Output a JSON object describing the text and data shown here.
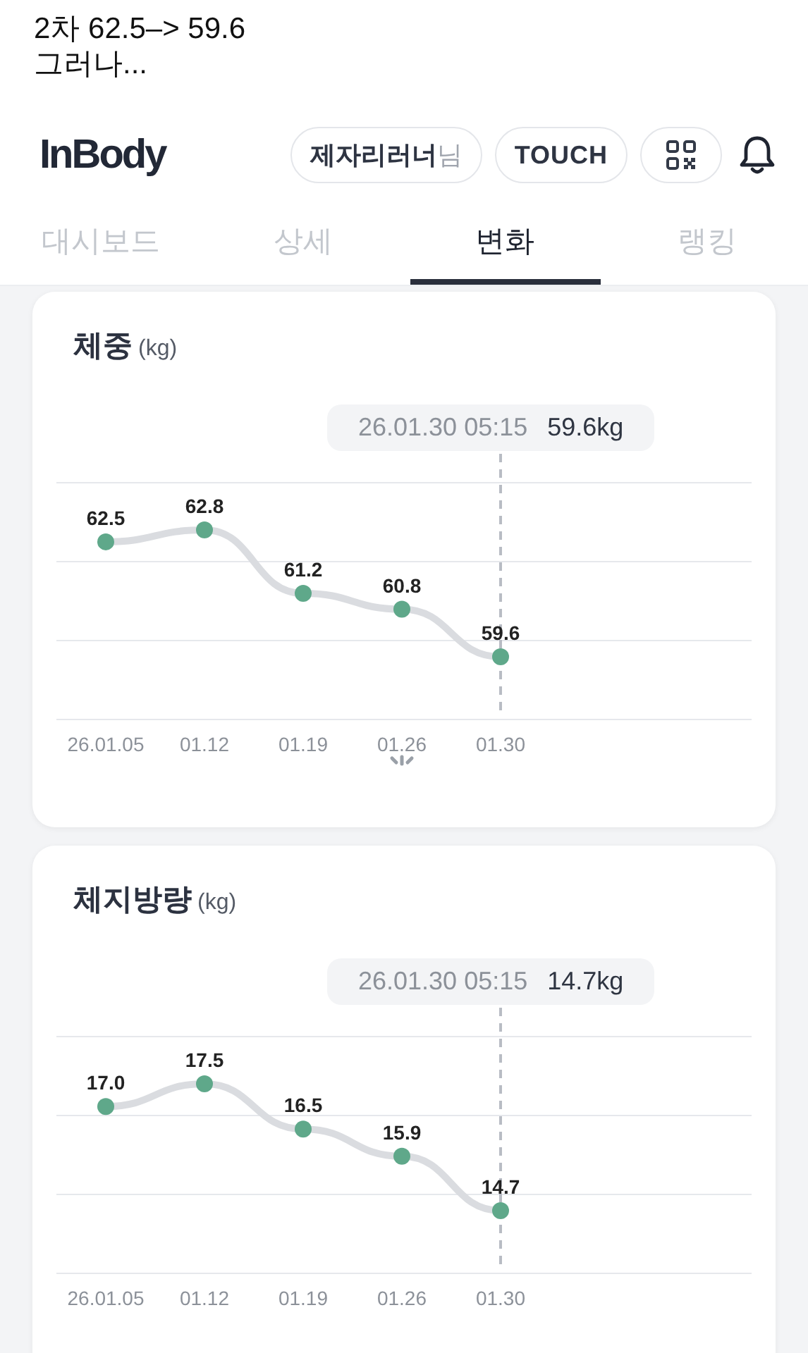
{
  "caption": {
    "lines": [
      "2차  62.5–> 59.6",
      "그러나..."
    ]
  },
  "header": {
    "logo": "InBody",
    "user": {
      "name": "제자리러너",
      "suffix": "님"
    },
    "touch_button": "TOUCH"
  },
  "tabs": [
    {
      "label": "대시보드",
      "selected": false
    },
    {
      "label": "상세",
      "selected": false
    },
    {
      "label": "변화",
      "selected": true
    },
    {
      "label": "랭킹",
      "selected": false
    }
  ],
  "cards": [
    {
      "tooltip": {
        "time": "26.01.30 05:15",
        "value": "59.6kg"
      },
      "chart_data": {
        "type": "line",
        "title": "체중",
        "ylabel": "(kg)",
        "categories": [
          "26.01.05",
          "01.12",
          "01.19",
          "01.26",
          "01.30"
        ],
        "series": [
          {
            "color": "#5fa88a",
            "marker": "o",
            "values": [
              62.5,
              62.8,
              61.2,
              60.8,
              59.6
            ],
            "value_labels": [
              "62.5",
              "62.8",
              "61.2",
              "60.8",
              "59.6"
            ]
          }
        ]
      }
    },
    {
      "tooltip": {
        "time": "26.01.30 05:15",
        "value": "14.7kg"
      },
      "chart_data": {
        "type": "line",
        "title": "체지방량",
        "ylabel": "(kg)",
        "categories": [
          "26.01.05",
          "01.12",
          "01.19",
          "01.26",
          "01.30"
        ],
        "series": [
          {
            "color": "#5fa88a",
            "marker": "o",
            "values": [
              17.0,
              17.5,
              16.5,
              15.9,
              14.7
            ],
            "value_labels": [
              "17.0",
              "17.5",
              "16.5",
              "15.9",
              "14.7"
            ]
          }
        ]
      }
    }
  ]
}
